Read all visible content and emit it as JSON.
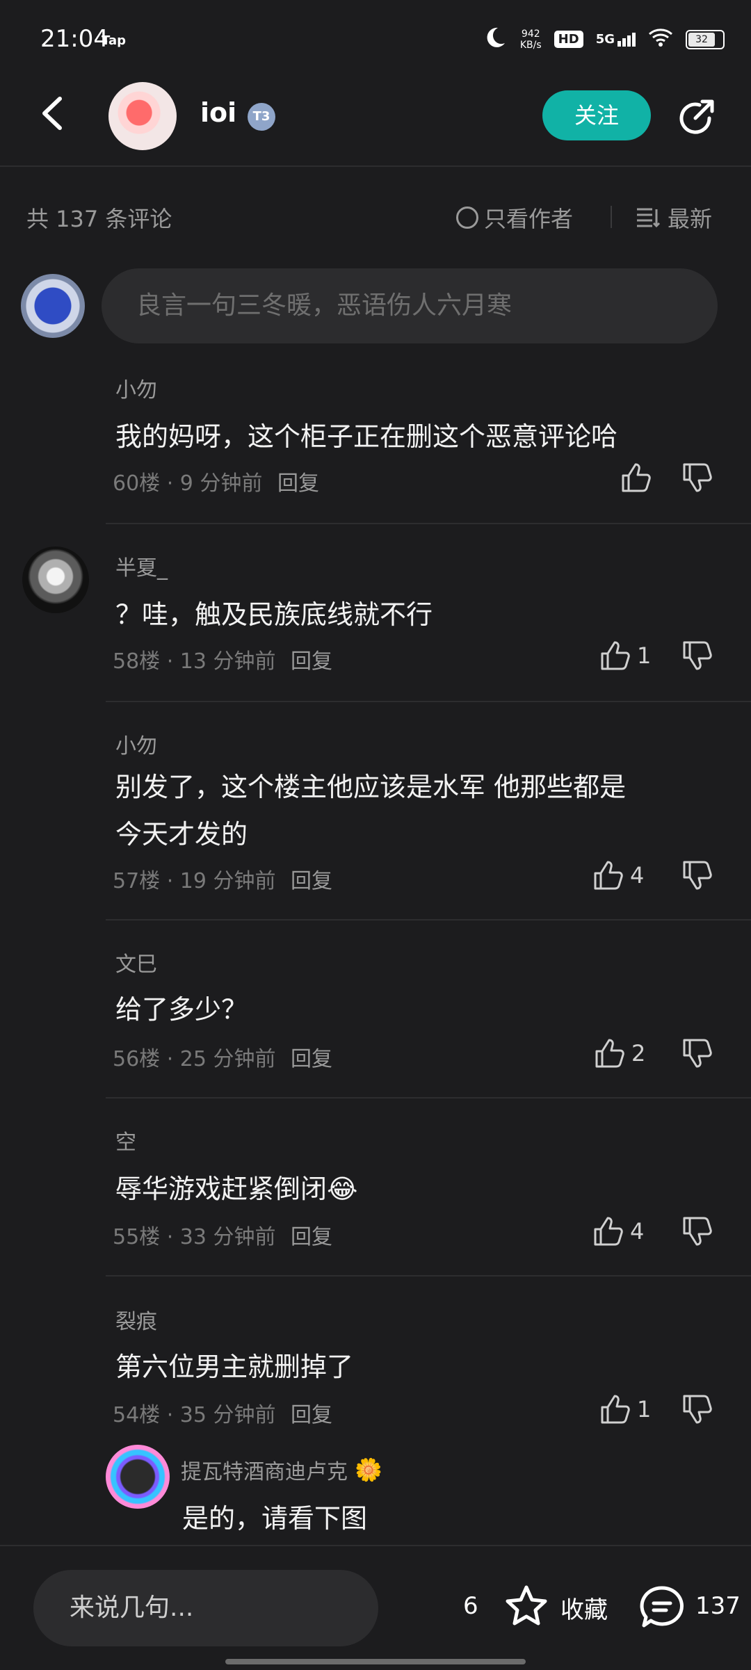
{
  "status_bar": {
    "time": "21:04",
    "app": "Tap",
    "net_speed_value": "942",
    "net_speed_unit": "KB/s",
    "hd": "HD",
    "network": "5G",
    "battery": "32"
  },
  "header": {
    "username": "ioi",
    "level_badge": "T3",
    "follow_label": "关注"
  },
  "filter_row": {
    "count_text": "共 137 条评论",
    "only_author_label": "只看作者",
    "sort_label": "最新"
  },
  "input": {
    "placeholder": "良言一句三冬暖，恶语伤人六月寒"
  },
  "comments": [
    {
      "author": "小勿",
      "text": "我的妈呀，这个柜子正在删这个恶意评论哈",
      "meta": "60楼 · 9 分钟前",
      "reply": "回复",
      "likes": ""
    },
    {
      "author": "半夏_",
      "text": "？哇，触及民族底线就不行",
      "meta": "58楼 · 13 分钟前",
      "reply": "回复",
      "likes": "1"
    },
    {
      "author": "小勿",
      "text_line1": "别发了，这个楼主他应该是水军 他那些都是",
      "text_line2": "今天才发的",
      "meta": "57楼 · 19 分钟前",
      "reply": "回复",
      "likes": "4"
    },
    {
      "author": "文巳",
      "text": "给了多少？",
      "meta": "56楼 · 25 分钟前",
      "reply": "回复",
      "likes": "2"
    },
    {
      "author": "空",
      "text": "辱华游戏赶紧倒闭😂",
      "meta": "55楼 · 33 分钟前",
      "reply": "回复",
      "likes": "4"
    },
    {
      "author": "裂痕",
      "text": "第六位男主就删掉了",
      "meta": "54楼 · 35 分钟前",
      "reply": "回复",
      "likes": "1"
    }
  ],
  "sub_reply": {
    "author": "提瓦特酒商迪卢克",
    "text": "是的，请看下图"
  },
  "bottom_bar": {
    "say_placeholder": "来说几句...",
    "fav_count": "6",
    "fav_label": "收藏",
    "comment_count": "137"
  }
}
